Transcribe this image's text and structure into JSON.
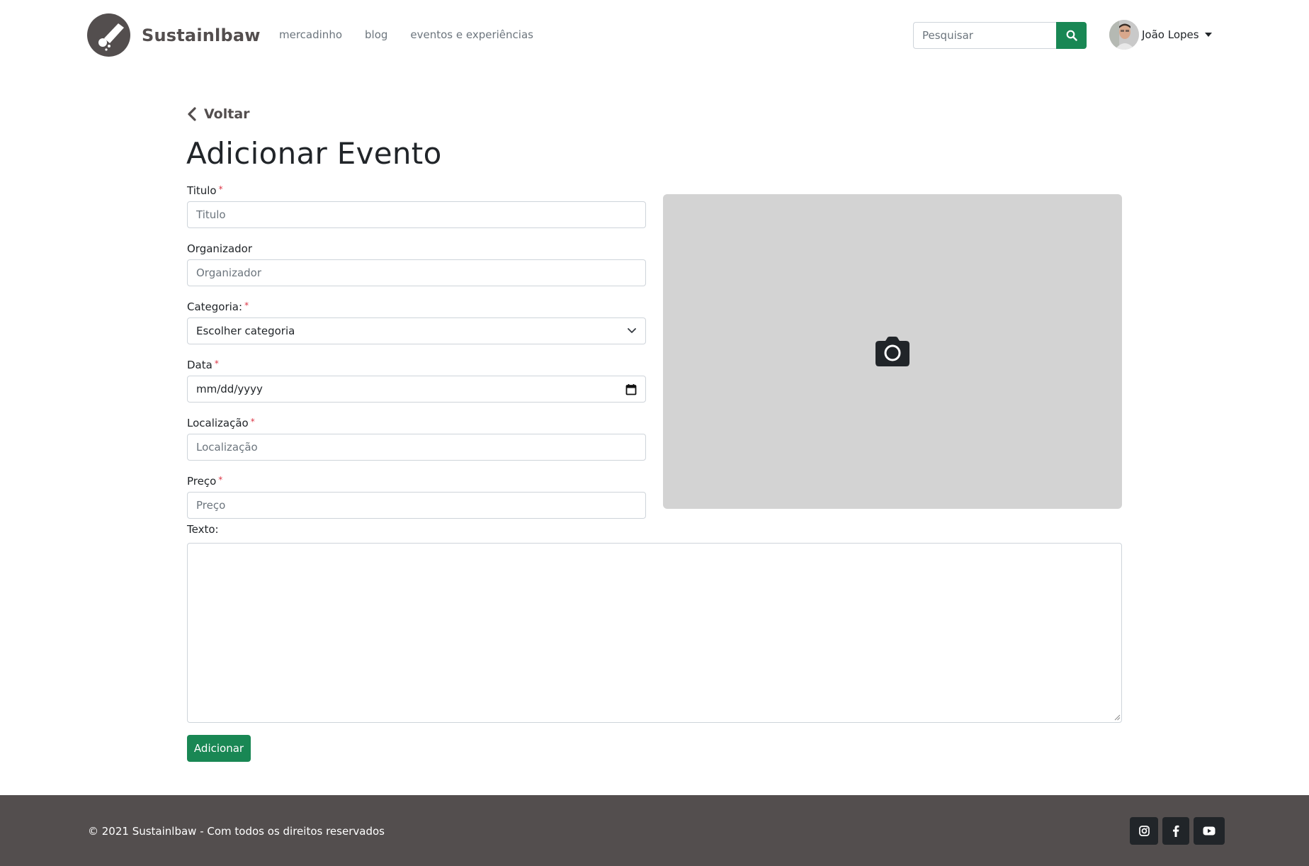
{
  "navbar": {
    "brand_name": "Sustainlbaw",
    "links": [
      "mercadinho",
      "blog",
      "eventos e experiências"
    ],
    "search": {
      "placeholder": "Pesquisar",
      "value": ""
    },
    "user_name": "João Lopes"
  },
  "main": {
    "back_label": "Voltar",
    "title": "Adicionar Evento",
    "fields": {
      "titulo": {
        "label": "Titulo",
        "required_mark": "*",
        "placeholder": "Titulo",
        "value": ""
      },
      "organizador": {
        "label": "Organizador",
        "placeholder": "Organizador",
        "value": ""
      },
      "categoria": {
        "label": "Categoria:",
        "required_mark": "*",
        "selected": "Escolher categoria"
      },
      "data": {
        "label": "Data",
        "required_mark": "*",
        "value": "mm/dd/yyyy"
      },
      "localizacao": {
        "label": "Localização",
        "required_mark": "*",
        "placeholder": "Localização",
        "value": ""
      },
      "preco": {
        "label": "Preço",
        "required_mark": "*",
        "placeholder": "Preço",
        "value": ""
      },
      "texto": {
        "label": "Texto:",
        "value": ""
      }
    },
    "submit_label": "Adicionar"
  },
  "footer": {
    "copyright": "© 2021 Sustainlbaw - Com todos os direitos reservados",
    "socials": [
      "instagram-icon",
      "facebook-icon",
      "youtube-icon"
    ]
  },
  "colors": {
    "brand": "#534e4e",
    "primary_green": "#198754",
    "image_placeholder": "#d3d3d3",
    "required": "#dc3545"
  }
}
